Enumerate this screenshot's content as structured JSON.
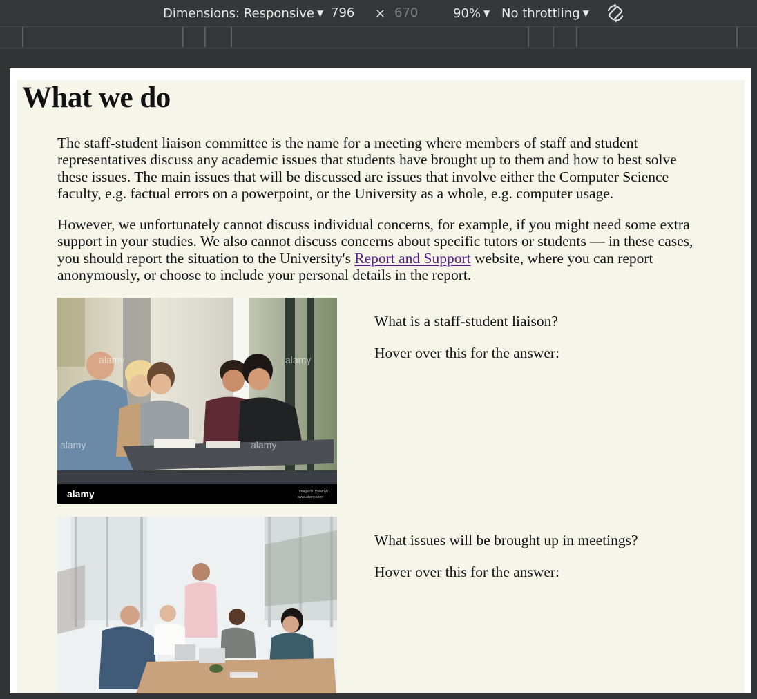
{
  "toolbar": {
    "dimensions_label": "Dimensions: Responsive",
    "width_value": "796",
    "times_symbol": "×",
    "height_placeholder": "670",
    "zoom_label": "90%",
    "throttling_label": "No throttling",
    "dropdown_caret": "▼",
    "rotate_icon": "rotate-icon"
  },
  "page": {
    "title": "What we do",
    "paragraph1": "The staff-student liaison committee is the name for a meeting where members of staff and student representatives discuss any academic issues that students have brought up to them and how to best solve these issues. The main issues that will be discussed are issues that involve either the Computer Science faculty, e.g. factual errors on a powerpoint, or the University as a whole, e.g. computer usage.",
    "paragraph2_before_link": "However, we unfortunately cannot discuss individual concerns, for example, if you might need some extra support in your studies. We also cannot discuss concerns about specific tutors or students — in these cases, you should report the situation to the University's ",
    "paragraph2_link": "Report and Support",
    "paragraph2_after_link": " website, where you can report anonymously, or choose to include your personal details in the report.",
    "sections": [
      {
        "question": "What is a staff-student liaison?",
        "hover_prompt": "Hover over this for the answer:",
        "image_watermark": "alamy",
        "image_caption": "Image ID: HNM0W",
        "image_site": "www.alamy.com"
      },
      {
        "question": "What issues will be brought up in meetings?",
        "hover_prompt": "Hover over this for the answer:"
      }
    ]
  },
  "colors": {
    "page_background": "#f6f5ea",
    "link_visited": "#551a8b",
    "devtools_bar": "#353637"
  }
}
